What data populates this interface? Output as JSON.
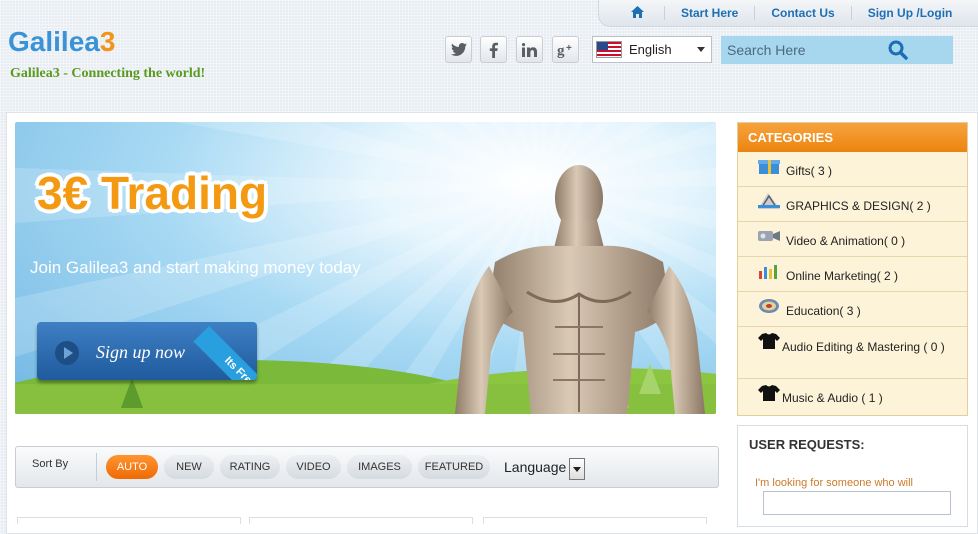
{
  "topnav": {
    "items": [
      "Start Here",
      "Contact Us",
      "Sign Up /Login"
    ]
  },
  "logo": {
    "text": "Galilea",
    "accent": "3"
  },
  "tagline": "Galilea3 - Connecting the world!",
  "social": [
    "twitter-icon",
    "facebook-icon",
    "linkedin-icon",
    "google-plus-icon"
  ],
  "language": {
    "selected": "English"
  },
  "search": {
    "placeholder": "Search Here"
  },
  "banner": {
    "title": "3€ Trading",
    "subtitle": "Join Galilea3 and start making money today",
    "cta": "Sign up now",
    "ribbon": "Its Free"
  },
  "categories": {
    "heading": "CATEGORIES",
    "items": [
      {
        "label": "Gifts( 3 )",
        "icon": "gift-icon"
      },
      {
        "label": "GRAPHICS & DESIGN( 2 )",
        "icon": "design-icon"
      },
      {
        "label": "Video & Animation( 0 )",
        "icon": "video-icon"
      },
      {
        "label": "Online Marketing( 2 )",
        "icon": "marketing-icon"
      },
      {
        "label": "Education( 3 )",
        "icon": "education-icon"
      },
      {
        "label": "Audio Editing & Mastering ( 0 )",
        "icon": "tshirt-icon"
      },
      {
        "label": "Music & Audio ( 1 )",
        "icon": "tshirt-icon"
      }
    ]
  },
  "user_requests": {
    "heading": "USER REQUESTS:",
    "hint": "I'm looking for someone who will"
  },
  "sortbar": {
    "label": "Sort By",
    "options": [
      "AUTO",
      "NEW",
      "RATING",
      "VIDEO",
      "IMAGES",
      "FEATURED"
    ],
    "active": "AUTO",
    "language_label": "Language"
  },
  "colors": {
    "accent": "#f2941a",
    "brand_blue": "#3a93d6",
    "green": "#5a9a1e",
    "active_pill": "#ef6a06"
  }
}
